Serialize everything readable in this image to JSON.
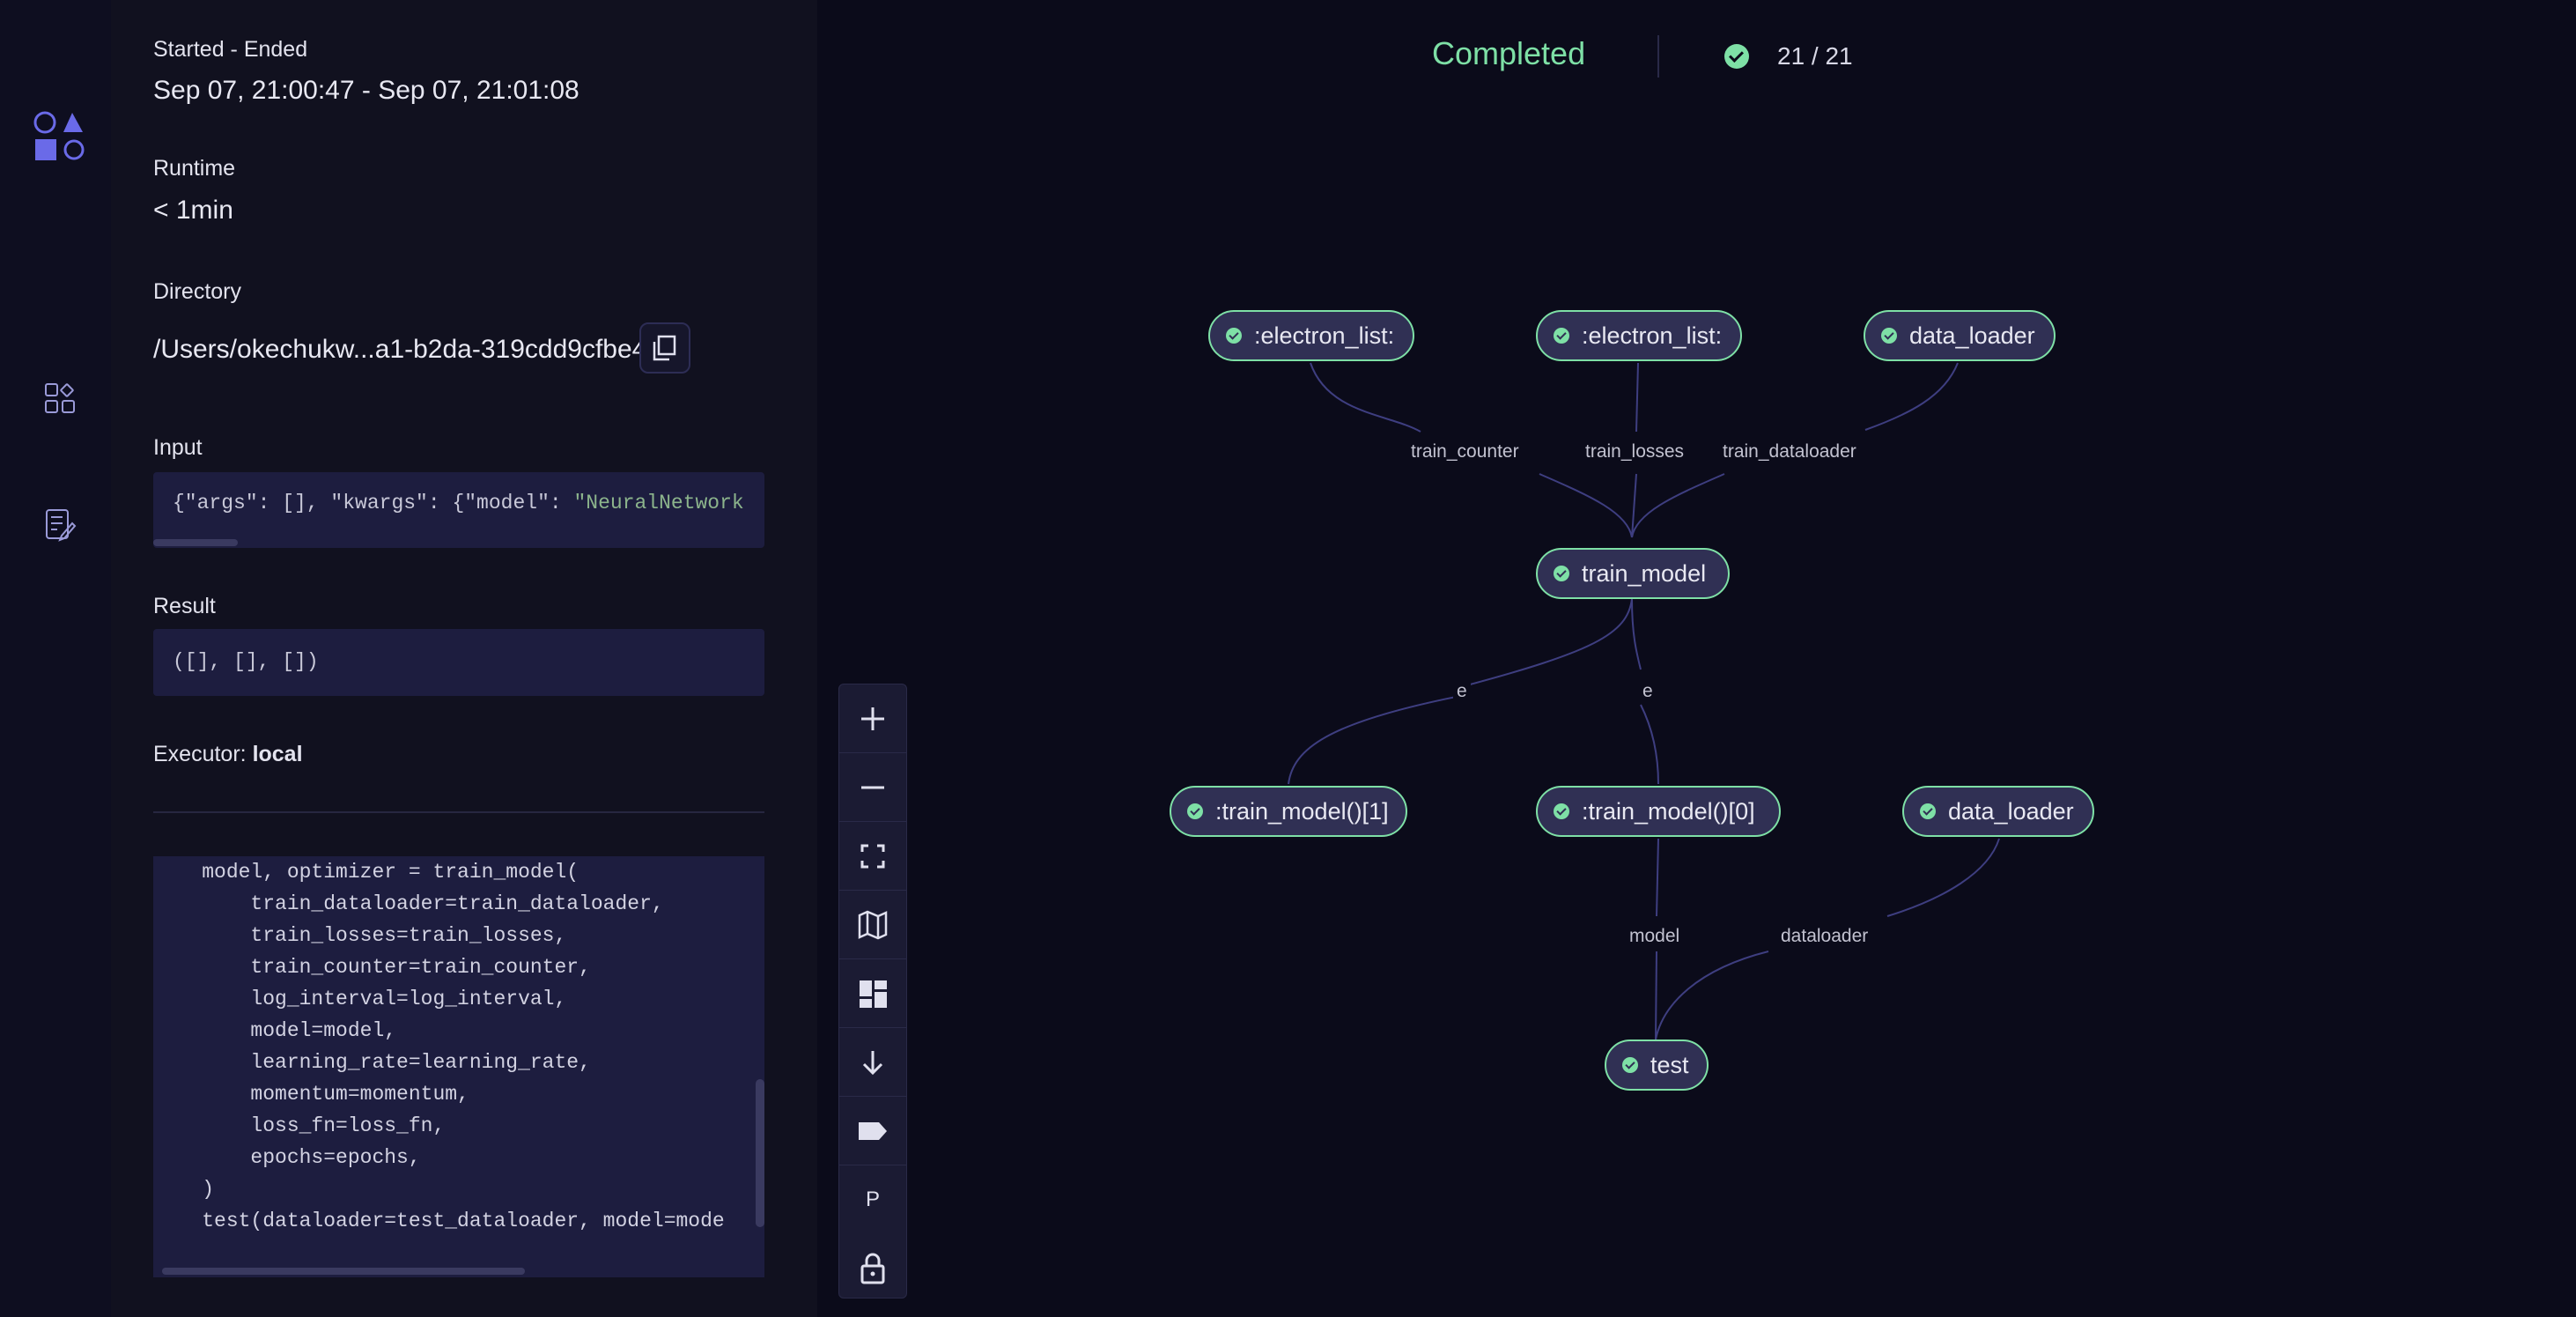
{
  "nav": {
    "items": [
      "lattice-logo",
      "dashboard-icon",
      "logs-icon"
    ]
  },
  "details": {
    "started_label": "Started - Ended",
    "started_value": "Sep 07, 21:00:47 - Sep 07, 21:01:08",
    "runtime_label": "Runtime",
    "runtime_value": "< 1min",
    "directory_label": "Directory",
    "directory_value": "/Users/okechukw...a1-b2da-319cdd9cfbe4",
    "input_label": "Input",
    "input_value": {
      "prefix": "{\"args\": [], \"kwargs\": {\"model\": ",
      "highlight": "\"NeuralNetwork"
    },
    "result_label": "Result",
    "result_value": "([], [], [])",
    "executor_label": "Executor: ",
    "executor_value": "local",
    "source_lines": [
      "    model, optimizer = train_model(",
      "        train_dataloader=train_dataloader,",
      "        train_losses=train_losses,",
      "        train_counter=train_counter,",
      "        log_interval=log_interval,",
      "        model=model,",
      "        learning_rate=learning_rate,",
      "        momentum=momentum,",
      "        loss_fn=loss_fn,",
      "        epochs=epochs,",
      "    )",
      "    test(dataloader=test_dataloader, model=mode"
    ]
  },
  "status": {
    "label": "Completed",
    "count": "21 / 21"
  },
  "graph": {
    "nodes": [
      ":electron_list:",
      ":electron_list:",
      "data_loader",
      "train_model",
      ":train_model()[1]",
      ":train_model()[0]",
      "data_loader",
      "test"
    ],
    "edge_labels": [
      "train_counter",
      "train_losses",
      "train_dataloader",
      "e",
      "e",
      "model",
      "dataloader"
    ]
  },
  "toolbar": {
    "items": [
      "zoom-in",
      "zoom-out",
      "fit-view",
      "minimap",
      "layout",
      "direction-down",
      "labels",
      "P",
      "lock"
    ]
  },
  "colors": {
    "success": "#7ee0a6",
    "node_bg": "#303054",
    "accent": "#6a6ae8"
  }
}
